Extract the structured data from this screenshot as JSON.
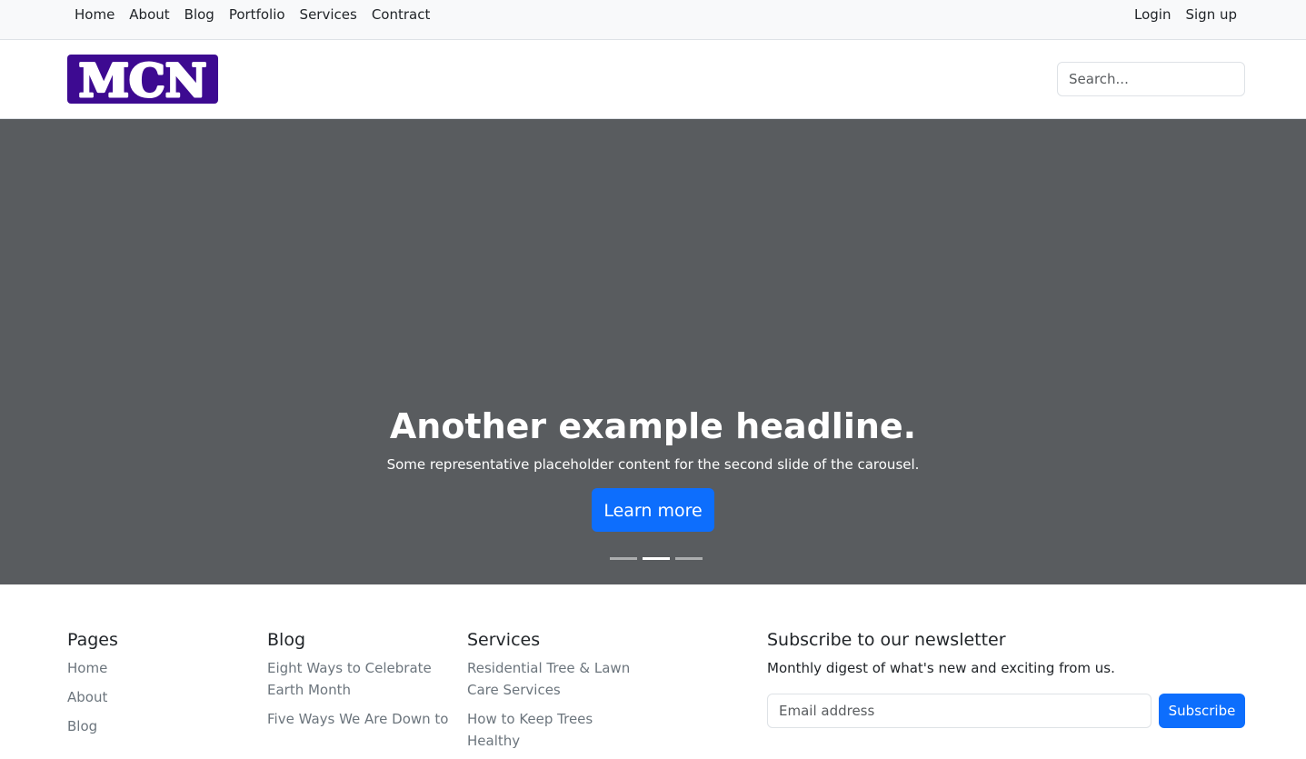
{
  "topnav": {
    "links": [
      "Home",
      "About",
      "Blog",
      "Portfolio",
      "Services",
      "Contract"
    ],
    "auth": [
      "Login",
      "Sign up"
    ]
  },
  "header": {
    "logo_text": "MCN",
    "search_placeholder": "Search...",
    "logo_color": "#3d0a91"
  },
  "carousel": {
    "headline": "Another example headline.",
    "text": "Some representative placeholder content for the second slide of the carousel.",
    "button_label": "Learn more",
    "active_index": 1,
    "slide_count": 3,
    "background_color": "#595c5f"
  },
  "footer": {
    "pages": {
      "title": "Pages",
      "items": [
        "Home",
        "About",
        "Blog"
      ]
    },
    "blog": {
      "title": "Blog",
      "items": [
        "Eight Ways to Celebrate Earth Month",
        "Five Ways We Are Down to"
      ]
    },
    "services": {
      "title": "Services",
      "items": [
        "Residential Tree & Lawn Care Services",
        "How to Keep Trees Healthy"
      ]
    },
    "newsletter": {
      "title": "Subscribe to our newsletter",
      "text": "Monthly digest of what's new and exciting from us.",
      "email_placeholder": "Email address",
      "button_label": "Subscribe"
    }
  },
  "colors": {
    "primary": "#0d6efd",
    "muted_text": "#6c757d"
  }
}
